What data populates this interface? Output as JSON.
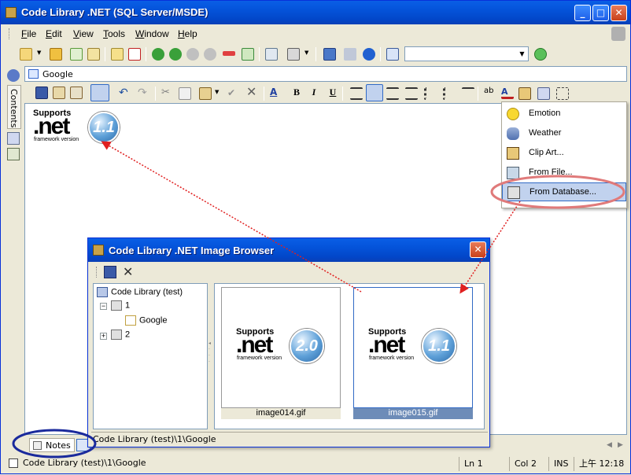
{
  "window": {
    "title": "Code Library .NET (SQL Server/MSDE)"
  },
  "menu": {
    "items": [
      {
        "pre": "",
        "key": "F",
        "post": "ile"
      },
      {
        "pre": "",
        "key": "E",
        "post": "dit"
      },
      {
        "pre": "",
        "key": "V",
        "post": "iew"
      },
      {
        "pre": "",
        "key": "T",
        "post": "ools"
      },
      {
        "pre": "",
        "key": "W",
        "post": "indow"
      },
      {
        "pre": "",
        "key": "H",
        "post": "elp"
      }
    ]
  },
  "address": {
    "label": "Google"
  },
  "sidebar": {
    "contents_label": "Contents"
  },
  "format_toolbar": {
    "bold": "B",
    "italic": "I",
    "underline": "U"
  },
  "editor": {
    "logo": {
      "supports": "Supports",
      "net": ".net",
      "version": "1.1",
      "tagline": "framework version"
    }
  },
  "insert_picture_menu": {
    "items": [
      {
        "label": "Emotion",
        "icon": "smiley-icon"
      },
      {
        "label": "Weather",
        "icon": "weather-icon"
      },
      {
        "label": "Clip Art...",
        "icon": "clipart-icon"
      },
      {
        "label": "From File...",
        "icon": "image-file-icon"
      },
      {
        "label": "From Database...",
        "icon": "database-image-icon"
      }
    ],
    "highlighted": "From Database..."
  },
  "image_browser": {
    "title": "Code Library .NET Image Browser",
    "tree": [
      {
        "label": "Code Library (test)"
      },
      {
        "label": "1"
      },
      {
        "label": "Google"
      },
      {
        "label": "2"
      }
    ],
    "images": [
      {
        "caption": "image014.gif",
        "supports": "Supports",
        "net": ".net",
        "version": "2.0",
        "tagline": "framework version"
      },
      {
        "caption": "image015.gif",
        "supports": "Supports",
        "net": ".net",
        "version": "1.1",
        "tagline": "framework version"
      }
    ],
    "status": "Code Library (test)\\1\\Google"
  },
  "bottom_tabs": {
    "notes": "Notes"
  },
  "statusbar": {
    "path": "Code Library (test)\\1\\Google",
    "line": "Ln 1",
    "col": "Col 2",
    "mode": "INS",
    "time": "上午 12:18"
  },
  "colors": {
    "titlebar": "#0453d9",
    "highlight_oval": "#e07a7a",
    "notes_oval": "#1a2a9c",
    "arrow": "#e02020"
  }
}
